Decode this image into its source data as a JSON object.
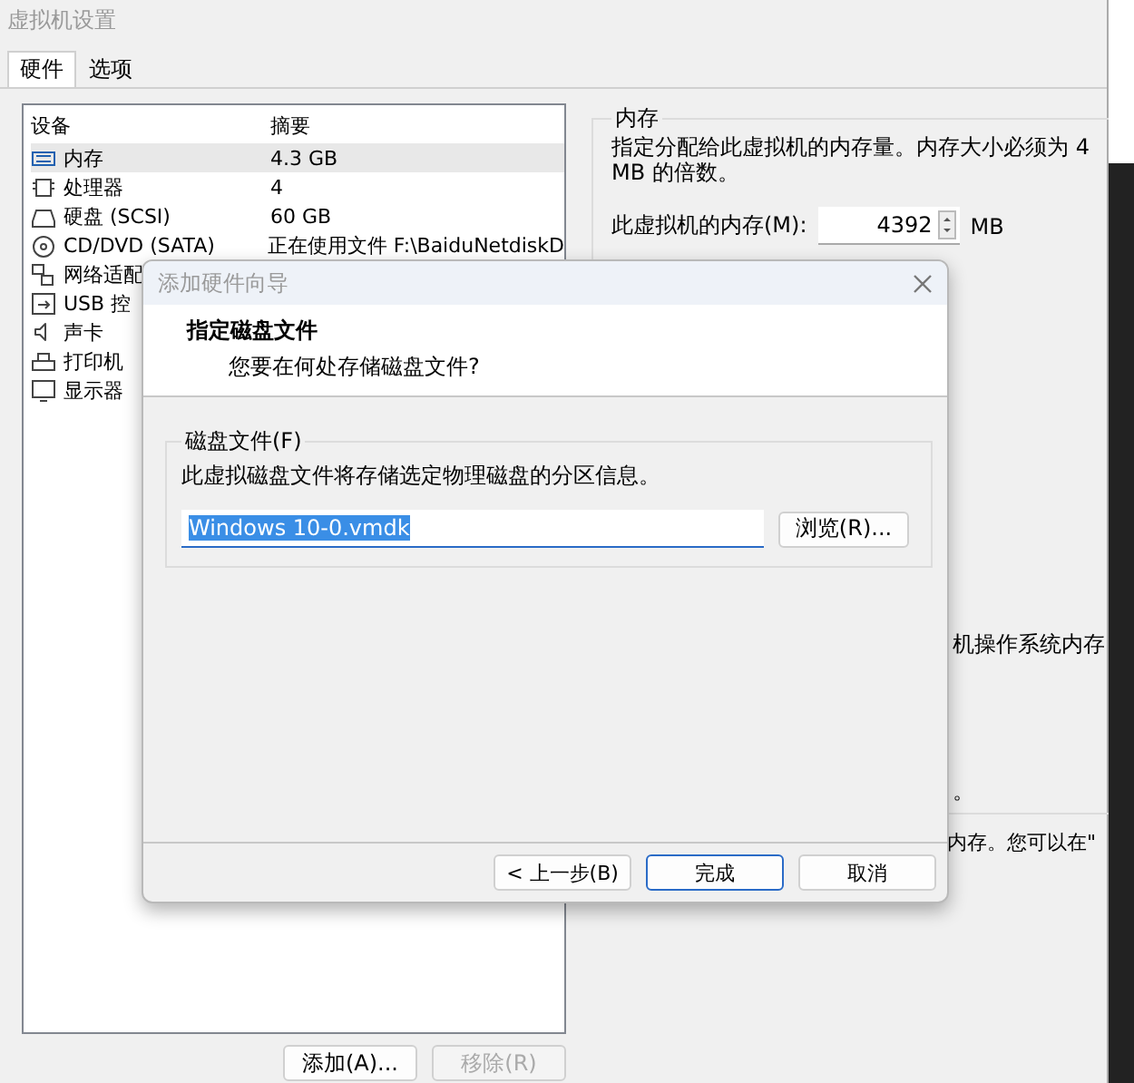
{
  "window": {
    "title": "虚拟机设置"
  },
  "tabs": [
    {
      "label": "硬件",
      "selected": true
    },
    {
      "label": "选项",
      "selected": false
    }
  ],
  "device_list": {
    "columns": [
      "设备",
      "摘要"
    ],
    "rows": [
      {
        "kind": "memory",
        "device": "内存",
        "summary": "4.3 GB",
        "selected": true
      },
      {
        "kind": "cpu",
        "device": "处理器",
        "summary": "4",
        "selected": false
      },
      {
        "kind": "disk",
        "device": "硬盘 (SCSI)",
        "summary": "60 GB",
        "selected": false
      },
      {
        "kind": "cd",
        "device": "CD/DVD (SATA)",
        "summary": "正在使用文件 F:\\BaiduNetdiskD",
        "selected": false
      },
      {
        "kind": "network",
        "device": "网络适配",
        "selected": false
      },
      {
        "kind": "usb",
        "device": "USB 控",
        "selected": false
      },
      {
        "kind": "sound",
        "device": "声卡",
        "selected": false
      },
      {
        "kind": "printer",
        "device": "打印机",
        "selected": false
      },
      {
        "kind": "display",
        "device": "显示器",
        "selected": false
      }
    ]
  },
  "list_buttons": [
    {
      "label": "添加(A)...",
      "disabled": false
    },
    {
      "label": "移除(R)",
      "disabled": true
    }
  ],
  "memory": {
    "title": "内存",
    "description": "指定分配给此虚拟机的内存量。内存大小必须为 4 MB 的倍数。",
    "field_label": "此虚拟机的内存(M):",
    "value": "4392",
    "unit": "MB",
    "partial_texts": [
      "机操作系统内存",
      "。"
    ],
    "below_text": "内存。您可以在\""
  },
  "dialog": {
    "title": "添加硬件向导",
    "heading": "指定磁盘文件",
    "subheading": "您要在何处存储磁盘文件?",
    "group_label": "磁盘文件(F)",
    "description": "此虚拟磁盘文件将存储选定物理磁盘的分区信息。",
    "file_field": {
      "value": "Windows 10-0.vmdk",
      "selected": true
    },
    "browse_button": "浏览(R)...",
    "buttons": [
      {
        "label": "< 上一步(B)",
        "default": false
      },
      {
        "label": "完成",
        "default": true
      },
      {
        "label": "取消",
        "default": false
      }
    ]
  }
}
